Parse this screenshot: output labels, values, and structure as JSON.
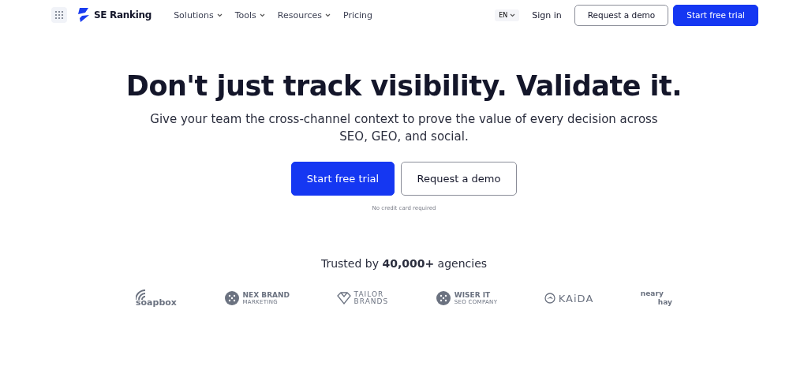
{
  "nav": {
    "brand": "SE Ranking",
    "menu": [
      {
        "label": "Solutions",
        "dropdown": true
      },
      {
        "label": "Tools",
        "dropdown": true
      },
      {
        "label": "Resources",
        "dropdown": true
      },
      {
        "label": "Pricing",
        "dropdown": false
      }
    ],
    "language": "EN",
    "sign_in": "Sign in",
    "demo_button": "Request a demo",
    "trial_button": "Start free trial"
  },
  "hero": {
    "headline": "Don't just track visibility. Validate it.",
    "subtitle": "Give your team the cross-channel context to prove the value of every decision across SEO, GEO, and social.",
    "primary_button": "Start free trial",
    "secondary_button": "Request a demo",
    "note": "No credit card required"
  },
  "trust": {
    "text": "Trusted by **40,000+** agencies",
    "logos": [
      {
        "kind": "soapbox",
        "name": "soapbox"
      },
      {
        "kind": "nexbrand",
        "name": "NEX BRAND",
        "tagline": "MARKETING"
      },
      {
        "kind": "tailor",
        "name": "TAILOR",
        "tagline": "BRANDS"
      },
      {
        "kind": "wiser",
        "name": "WISER IT",
        "tagline": "SEO COMPANY"
      },
      {
        "kind": "kaida",
        "name": "KAiDA"
      },
      {
        "kind": "neary",
        "name": "neary",
        "tagline": "hay"
      }
    ]
  }
}
